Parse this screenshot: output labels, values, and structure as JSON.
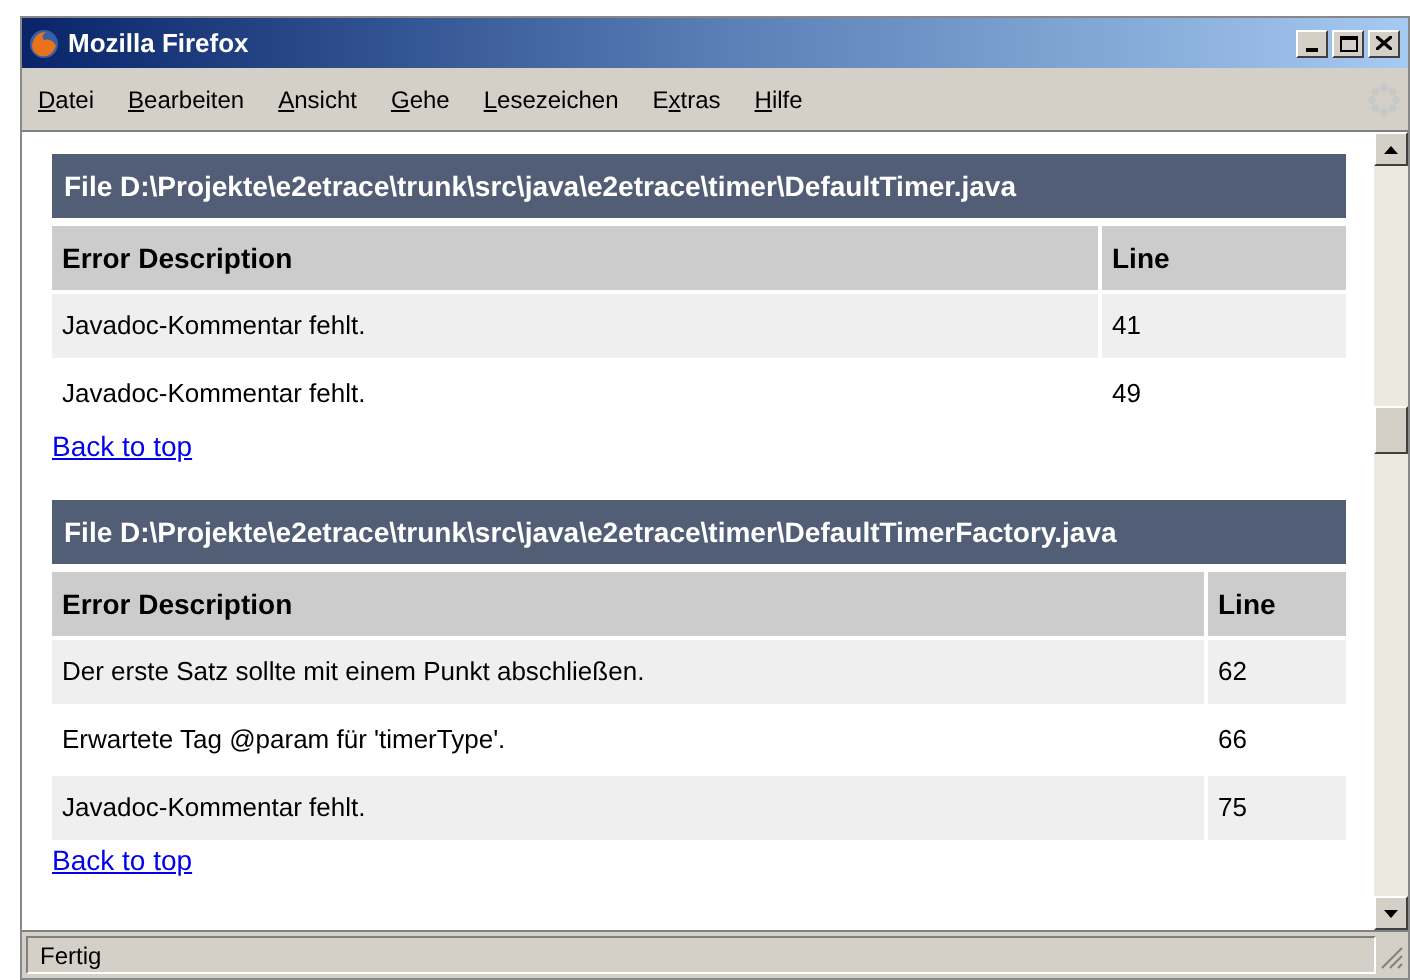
{
  "window": {
    "title": "Mozilla Firefox"
  },
  "menu": [
    {
      "key": "D",
      "after": "atei"
    },
    {
      "key": "B",
      "after": "earbeiten"
    },
    {
      "key": "A",
      "after": "nsicht"
    },
    {
      "key": "G",
      "after": "ehe"
    },
    {
      "key": "L",
      "after": "esezeichen"
    },
    {
      "before": "E",
      "key": "x",
      "after": "tras"
    },
    {
      "key": "H",
      "after": "ilfe"
    }
  ],
  "sections": [
    {
      "title": "File D:\\Projekte\\e2etrace\\trunk\\src\\java\\e2etrace\\timer\\DefaultTimer.java",
      "columns": [
        "Error Description",
        "Line"
      ],
      "rows": [
        [
          "Javadoc-Kommentar fehlt.",
          "41"
        ],
        [
          "Javadoc-Kommentar fehlt.",
          "49"
        ]
      ],
      "back_link": "Back to top"
    },
    {
      "title": "File D:\\Projekte\\e2etrace\\trunk\\src\\java\\e2etrace\\timer\\DefaultTimerFactory.java",
      "columns": [
        "Error Description",
        "Line"
      ],
      "rows": [
        [
          "Der erste Satz sollte mit einem Punkt abschließen.",
          "62"
        ],
        [
          "Erwartete Tag @param für 'timerType'.",
          "66"
        ],
        [
          "Javadoc-Kommentar fehlt.",
          "75"
        ]
      ],
      "back_link": "Back to top"
    }
  ],
  "status_bar": "Fertig"
}
